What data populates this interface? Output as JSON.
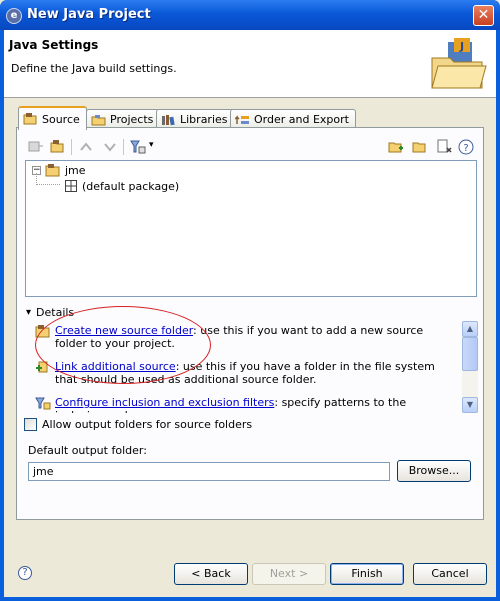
{
  "window": {
    "title": "New Java Project",
    "close_symbol": "✕"
  },
  "banner": {
    "title": "Java Settings",
    "description": "Define the Java build settings."
  },
  "tabs": [
    {
      "label": "Source",
      "icon": "source-folder-icon",
      "active": true
    },
    {
      "label": "Projects",
      "icon": "projects-icon",
      "active": false
    },
    {
      "label": "Libraries",
      "icon": "libraries-icon",
      "active": false
    },
    {
      "label": "Order and Export",
      "icon": "order-export-icon",
      "active": false
    }
  ],
  "tree": {
    "root_toggle": "−",
    "root": "jme",
    "child": "(default package)"
  },
  "details": {
    "toggle": "▾",
    "label": "Details",
    "items": [
      {
        "link": "Create new source folder",
        "text": ": use this if you want to add a new source folder to your project.",
        "icon": "new-source-folder-icon"
      },
      {
        "link": "Link additional source",
        "text": ": use this if you have a folder in the file system that should be used as additional source folder.",
        "icon": "link-source-icon"
      },
      {
        "link": "Configure inclusion and exclusion filters",
        "text": ": specify patterns to the inclusion and",
        "icon": "configure-filters-icon"
      }
    ]
  },
  "allow_output": {
    "label": "Allow output folders for source folders",
    "checked": false
  },
  "output": {
    "label": "Default output folder:",
    "value": "jme",
    "browse_label": "Browse..."
  },
  "buttons": {
    "back": "< Back",
    "next": "Next >",
    "finish": "Finish",
    "cancel": "Cancel"
  },
  "help_symbol": "?",
  "scroll": {
    "up": "▲",
    "down": "▼"
  },
  "dropdown_arrow": "▾",
  "colors": {
    "link": "#0000cc",
    "highlight": "#d62020",
    "title_bar": "#0a58d8"
  }
}
